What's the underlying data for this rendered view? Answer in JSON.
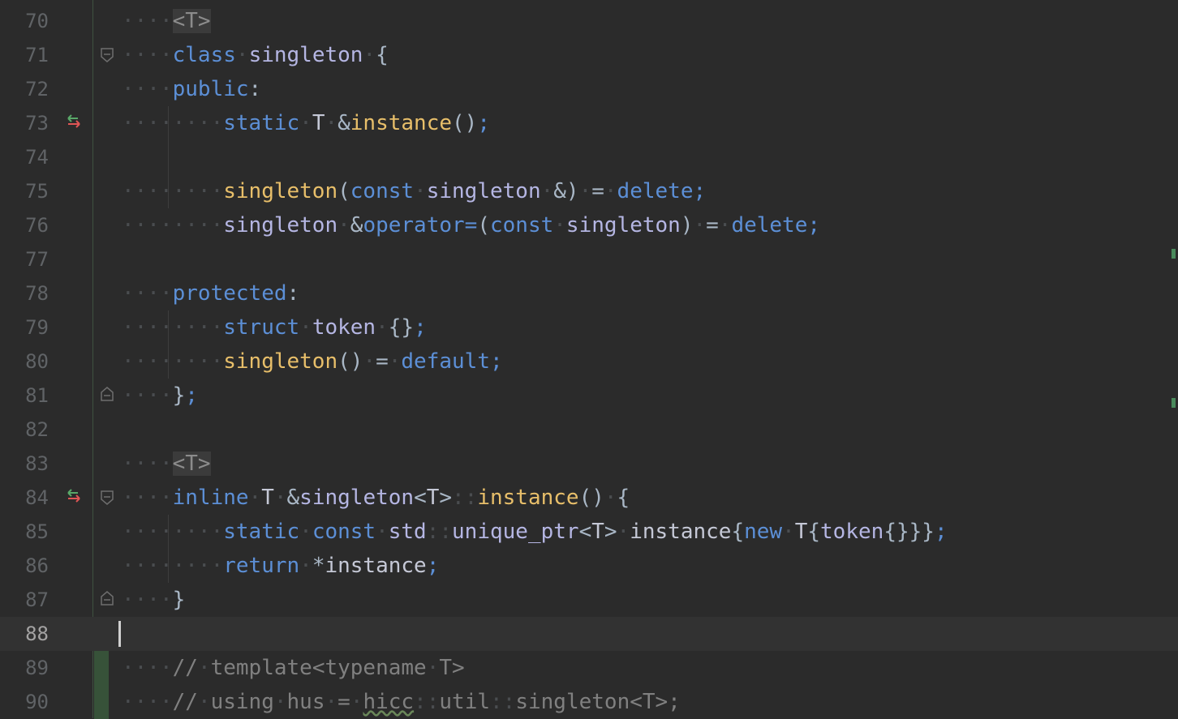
{
  "editor": {
    "current_line": 88,
    "lines": [
      {
        "n": "70",
        "tokens": [
          [
            "ws",
            "····"
          ],
          [
            "hint",
            "<T>"
          ]
        ]
      },
      {
        "n": "71",
        "tokens": [
          [
            "ws",
            "····"
          ],
          [
            "kw",
            "class"
          ],
          [
            "ws",
            "·"
          ],
          [
            "cls",
            "singleton"
          ],
          [
            "ws",
            "·"
          ],
          [
            "op",
            "{"
          ]
        ]
      },
      {
        "n": "72",
        "tokens": [
          [
            "ws",
            "····"
          ],
          [
            "kw",
            "public"
          ],
          [
            "op",
            ":"
          ]
        ]
      },
      {
        "n": "73",
        "tokens": [
          [
            "ws",
            "········"
          ],
          [
            "kw",
            "static"
          ],
          [
            "ws",
            "·"
          ],
          [
            "id",
            "T"
          ],
          [
            "ws",
            "·"
          ],
          [
            "op",
            "&"
          ],
          [
            "fn",
            "instance"
          ],
          [
            "op",
            "()"
          ],
          [
            "punc",
            ";"
          ]
        ]
      },
      {
        "n": "74",
        "tokens": []
      },
      {
        "n": "75",
        "tokens": [
          [
            "ws",
            "········"
          ],
          [
            "fn",
            "singleton"
          ],
          [
            "op",
            "("
          ],
          [
            "kw",
            "const"
          ],
          [
            "ws",
            "·"
          ],
          [
            "cls",
            "singleton"
          ],
          [
            "ws",
            "·"
          ],
          [
            "op",
            "&)"
          ],
          [
            "ws",
            "·"
          ],
          [
            "op",
            "="
          ],
          [
            "ws",
            "·"
          ],
          [
            "kw",
            "delete"
          ],
          [
            "punc",
            ";"
          ]
        ]
      },
      {
        "n": "76",
        "tokens": [
          [
            "ws",
            "········"
          ],
          [
            "cls",
            "singleton"
          ],
          [
            "ws",
            "·"
          ],
          [
            "op",
            "&"
          ],
          [
            "kw",
            "operator="
          ],
          [
            "op",
            "("
          ],
          [
            "kw",
            "const"
          ],
          [
            "ws",
            "·"
          ],
          [
            "cls",
            "singleton"
          ],
          [
            "op",
            ")"
          ],
          [
            "ws",
            "·"
          ],
          [
            "op",
            "="
          ],
          [
            "ws",
            "·"
          ],
          [
            "kw",
            "delete"
          ],
          [
            "punc",
            ";"
          ]
        ]
      },
      {
        "n": "77",
        "tokens": []
      },
      {
        "n": "78",
        "tokens": [
          [
            "ws",
            "····"
          ],
          [
            "kw",
            "protected"
          ],
          [
            "op",
            ":"
          ]
        ]
      },
      {
        "n": "79",
        "tokens": [
          [
            "ws",
            "········"
          ],
          [
            "kw",
            "struct"
          ],
          [
            "ws",
            "·"
          ],
          [
            "cls",
            "token"
          ],
          [
            "ws",
            "·"
          ],
          [
            "op",
            "{}"
          ],
          [
            "punc",
            ";"
          ]
        ]
      },
      {
        "n": "80",
        "tokens": [
          [
            "ws",
            "········"
          ],
          [
            "fn",
            "singleton"
          ],
          [
            "op",
            "()"
          ],
          [
            "ws",
            "·"
          ],
          [
            "op",
            "="
          ],
          [
            "ws",
            "·"
          ],
          [
            "kw",
            "default"
          ],
          [
            "punc",
            ";"
          ]
        ]
      },
      {
        "n": "81",
        "tokens": [
          [
            "ws",
            "····"
          ],
          [
            "op",
            "}"
          ],
          [
            "punc",
            ";"
          ]
        ]
      },
      {
        "n": "82",
        "tokens": []
      },
      {
        "n": "83",
        "tokens": [
          [
            "ws",
            "····"
          ],
          [
            "hint",
            "<T>"
          ]
        ]
      },
      {
        "n": "84",
        "tokens": [
          [
            "ws",
            "····"
          ],
          [
            "kw",
            "inline"
          ],
          [
            "ws",
            "·"
          ],
          [
            "id",
            "T"
          ],
          [
            "ws",
            "·"
          ],
          [
            "op",
            "&"
          ],
          [
            "cls",
            "singleton"
          ],
          [
            "op",
            "<"
          ],
          [
            "id",
            "T"
          ],
          [
            "op",
            ">"
          ],
          [
            "ws",
            "::"
          ],
          [
            "fn",
            "instance"
          ],
          [
            "op",
            "()"
          ],
          [
            "ws",
            "·"
          ],
          [
            "op",
            "{"
          ]
        ]
      },
      {
        "n": "85",
        "tokens": [
          [
            "ws",
            "········"
          ],
          [
            "kw",
            "static"
          ],
          [
            "ws",
            "·"
          ],
          [
            "kw",
            "const"
          ],
          [
            "ws",
            "·"
          ],
          [
            "cls",
            "std"
          ],
          [
            "ws",
            "::"
          ],
          [
            "cls",
            "unique_ptr"
          ],
          [
            "op",
            "<"
          ],
          [
            "id",
            "T"
          ],
          [
            "op",
            ">"
          ],
          [
            "ws",
            "·"
          ],
          [
            "id",
            "instance"
          ],
          [
            "op",
            "{"
          ],
          [
            "kw",
            "new"
          ],
          [
            "ws",
            "·"
          ],
          [
            "id",
            "T"
          ],
          [
            "op",
            "{"
          ],
          [
            "cls",
            "token"
          ],
          [
            "op",
            "{}}}"
          ],
          [
            "punc",
            ";"
          ]
        ]
      },
      {
        "n": "86",
        "tokens": [
          [
            "ws",
            "········"
          ],
          [
            "kw",
            "return"
          ],
          [
            "ws",
            "·"
          ],
          [
            "op",
            "*"
          ],
          [
            "id",
            "instance"
          ],
          [
            "punc",
            ";"
          ]
        ]
      },
      {
        "n": "87",
        "tokens": [
          [
            "ws",
            "····"
          ],
          [
            "op",
            "}"
          ]
        ]
      },
      {
        "n": "88",
        "tokens": []
      },
      {
        "n": "89",
        "tokens": [
          [
            "ws",
            "····"
          ],
          [
            "cmt",
            "//"
          ],
          [
            "ws",
            "·"
          ],
          [
            "cmt",
            "template<typename"
          ],
          [
            "ws",
            "·"
          ],
          [
            "cmt",
            "T>"
          ]
        ]
      },
      {
        "n": "90",
        "tokens": [
          [
            "ws",
            "····"
          ],
          [
            "cmt",
            "//"
          ],
          [
            "ws",
            "·"
          ],
          [
            "cmt",
            "using"
          ],
          [
            "ws",
            "·"
          ],
          [
            "cmt",
            "hus"
          ],
          [
            "ws",
            "·"
          ],
          [
            "cmt",
            "="
          ],
          [
            "ws",
            "·"
          ],
          [
            "err",
            "hicc"
          ],
          [
            "ws",
            "::"
          ],
          [
            "cmt",
            "util"
          ],
          [
            "ws",
            "::"
          ],
          [
            "cmt",
            "singleton<T>;"
          ]
        ]
      }
    ],
    "override_marker_lines": [
      "73",
      "84"
    ],
    "fold_open_lines": [
      "71",
      "84"
    ],
    "fold_close_lines": [
      "81",
      "87"
    ],
    "vcs_added_lines": [
      "89",
      "90"
    ]
  },
  "icons": {
    "override": "implements-override-icon",
    "fold_open": "fold-open-icon",
    "fold_close": "fold-close-icon"
  },
  "colors": {
    "background": "#2b2b2b",
    "keyword": "#5c8fd6",
    "function": "#e8bf6a",
    "class": "#b5b6e3",
    "comment": "#808080",
    "vcs_added": "#375239"
  }
}
